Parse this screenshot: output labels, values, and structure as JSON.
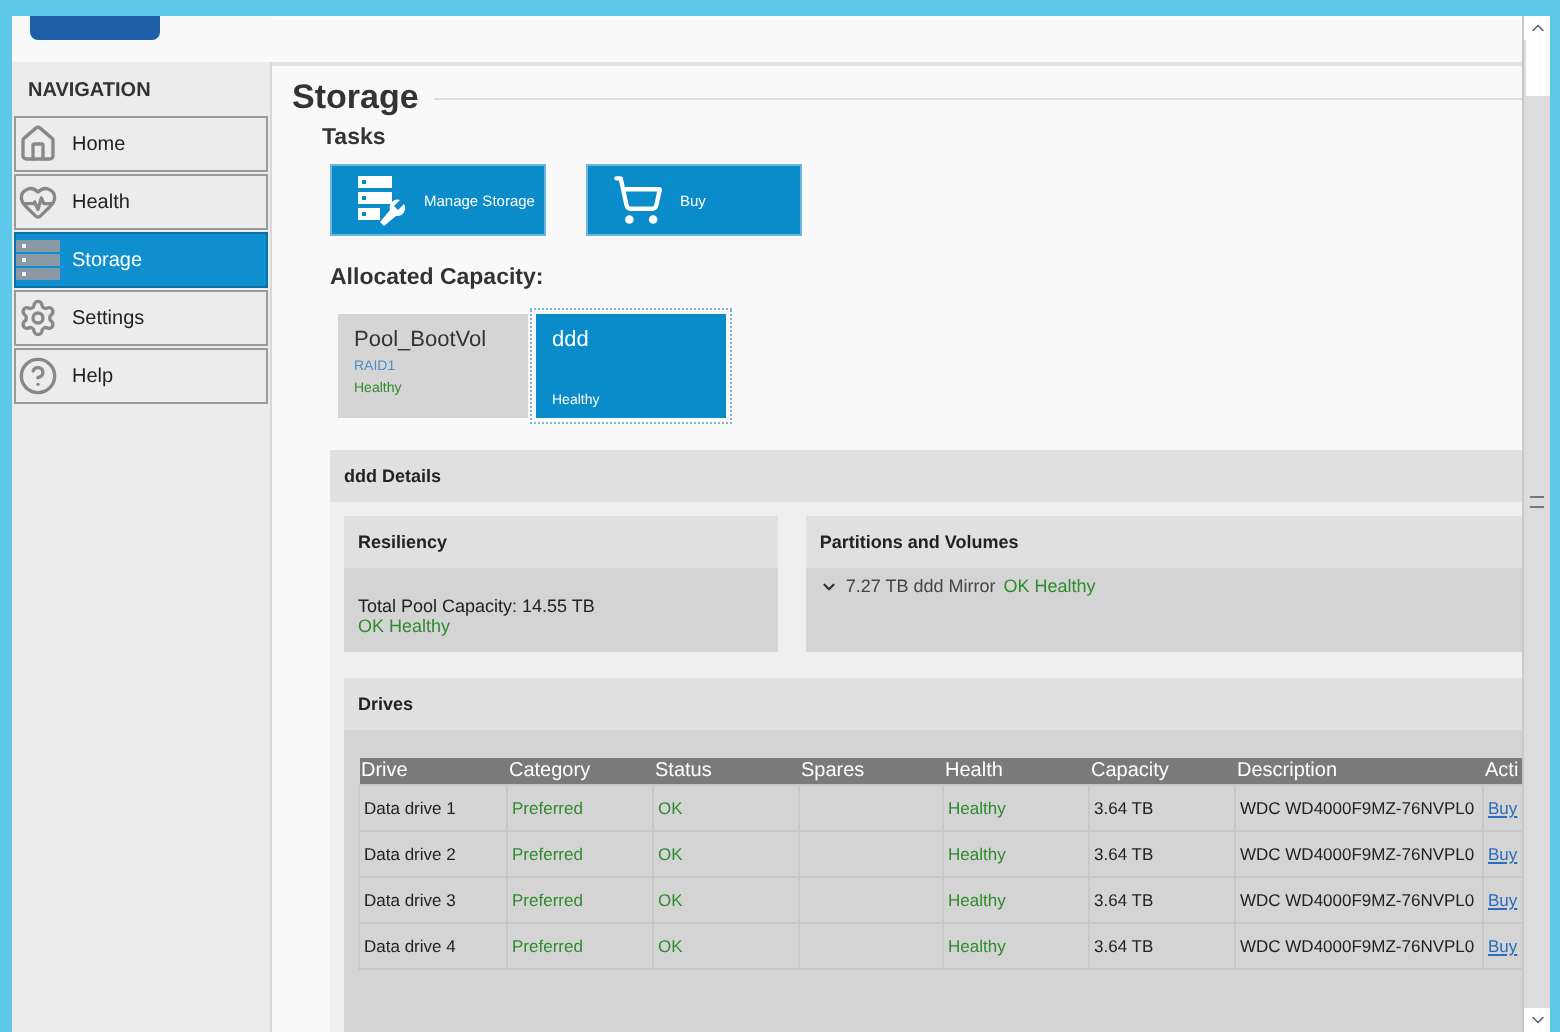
{
  "navigation": {
    "title": "NAVIGATION",
    "items": [
      {
        "label": "Home",
        "kind": "home",
        "selected": false
      },
      {
        "label": "Health",
        "kind": "health",
        "selected": false
      },
      {
        "label": "Storage",
        "kind": "storage",
        "selected": true
      },
      {
        "label": "Settings",
        "kind": "settings",
        "selected": false
      },
      {
        "label": "Help",
        "kind": "help",
        "selected": false
      }
    ]
  },
  "page_title": "Storage",
  "tasks": {
    "title": "Tasks",
    "items": [
      {
        "label": "Manage Storage",
        "kind": "manage"
      },
      {
        "label": "Buy",
        "kind": "buy"
      }
    ]
  },
  "allocated": {
    "title": "Allocated Capacity:",
    "pools": [
      {
        "name": "Pool_BootVol",
        "raid": "RAID1",
        "status": "Healthy",
        "selected": false
      },
      {
        "name": "ddd",
        "status": "Healthy",
        "selected": true
      }
    ]
  },
  "details": {
    "title": "ddd Details",
    "resiliency": {
      "title": "Resiliency",
      "capacity": "Total Pool Capacity: 14.55 TB",
      "status": "OK Healthy"
    },
    "partitions": {
      "title": "Partitions and Volumes",
      "items": [
        {
          "text": "7.27 TB ddd Mirror",
          "status": "OK Healthy",
          "expanded": true
        }
      ]
    },
    "drives": {
      "title": "Drives",
      "columns": [
        "Drive",
        "Category",
        "Status",
        "Spares",
        "Health",
        "Capacity",
        "Description",
        "Acti"
      ],
      "rows": [
        {
          "drive": "Data drive 1",
          "category": "Preferred",
          "status": "OK",
          "health": "Healthy",
          "capacity": "3.64 TB",
          "description": "WDC WD4000F9MZ-76NVPL0",
          "action": "Buy"
        },
        {
          "drive": "Data drive 2",
          "category": "Preferred",
          "status": "OK",
          "health": "Healthy",
          "capacity": "3.64 TB",
          "description": "WDC WD4000F9MZ-76NVPL0",
          "action": "Buy"
        },
        {
          "drive": "Data drive 3",
          "category": "Preferred",
          "status": "OK",
          "health": "Healthy",
          "capacity": "3.64 TB",
          "description": "WDC WD4000F9MZ-76NVPL0",
          "action": "Buy"
        },
        {
          "drive": "Data drive 4",
          "category": "Preferred",
          "status": "OK",
          "health": "Healthy",
          "capacity": "3.64 TB",
          "description": "WDC WD4000F9MZ-76NVPL0",
          "action": "Buy"
        }
      ]
    }
  }
}
